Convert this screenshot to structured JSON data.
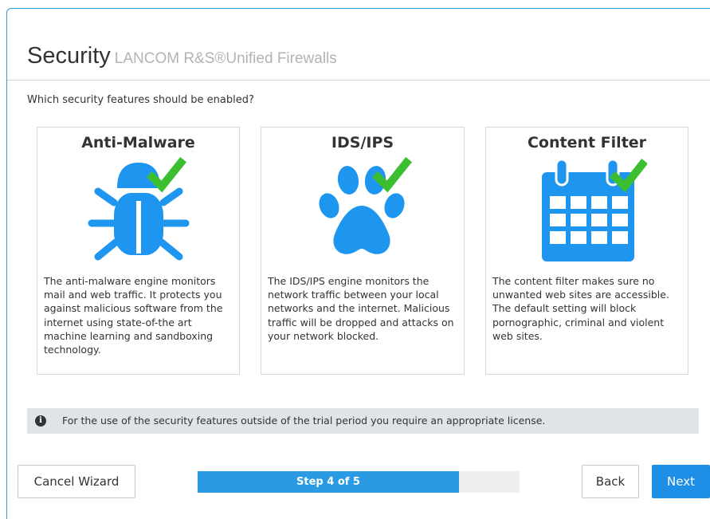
{
  "header": {
    "title": "Security",
    "subtitle": "LANCOM R&S®Unified Firewalls"
  },
  "question": "Which security features should be enabled?",
  "features": [
    {
      "title": "Anti-Malware",
      "icon": "bug-icon",
      "enabled": true,
      "description": "The anti-malware engine monitors mail and web traffic. It protects you against malicious software from the internet using state-of-the art machine learning and sandboxing technology."
    },
    {
      "title": "IDS/IPS",
      "icon": "paw-icon",
      "enabled": true,
      "description": "The IDS/IPS engine monitors the network traffic between your local networks and the internet. Malicious traffic will be dropped and attacks on your network blocked."
    },
    {
      "title": "Content Filter",
      "icon": "calendar-icon",
      "enabled": true,
      "description": "The content filter makes sure no unwanted web sites are accessible. The default setting will block pornographic, criminal and violent web sites."
    }
  ],
  "info": {
    "icon": "info-icon",
    "text": "For the use of the security features outside of the trial period you require an appropriate license."
  },
  "footer": {
    "cancel_label": "Cancel Wizard",
    "progress_label": "Step 4 of 5",
    "progress_fraction": 0.8,
    "back_label": "Back",
    "next_label": "Next"
  },
  "colors": {
    "accent": "#1e8fe6",
    "icon_blue": "#1e96f0",
    "check_green": "#3bbf30",
    "frame_border": "#2f9bd8"
  }
}
